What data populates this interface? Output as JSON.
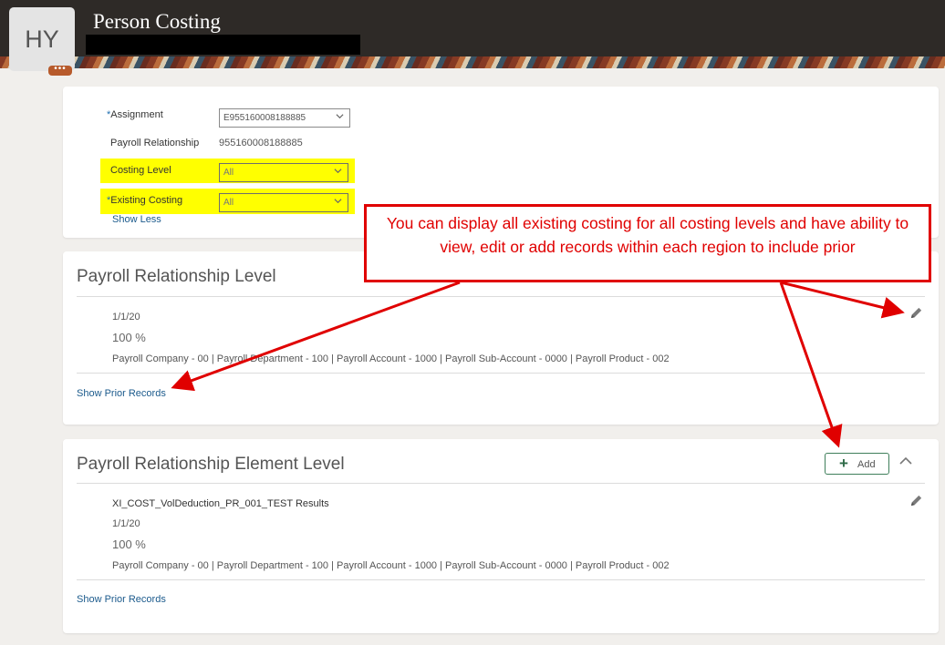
{
  "header": {
    "title": "Person Costing",
    "avatar_initials": "HY",
    "avatar_more": "•••"
  },
  "assignment_form": {
    "assignment_label": "Assignment",
    "assignment_value": "E955160008188885",
    "payroll_relationship_label": "Payroll Relationship",
    "payroll_relationship_value": "955160008188885",
    "costing_level_label": "Costing Level",
    "costing_level_value": "All",
    "existing_costing_label": "Existing Costing",
    "existing_costing_value": "All",
    "show_less": "Show Less",
    "required_marker": "*",
    "highlight_color": "#ffff00"
  },
  "sections": [
    {
      "title": "Payroll Relationship Level",
      "record": {
        "date": "1/1/20",
        "percent": "100 %",
        "account": "Payroll Company - 00 | Payroll Department - 100 | Payroll Account - 1000 | Payroll Sub-Account - 0000 | Payroll Product - 002"
      },
      "show_prior": "Show Prior Records"
    },
    {
      "title": "Payroll Relationship Element Level",
      "add_label": "Add",
      "record": {
        "element": "XI_COST_VolDeduction_PR_001_TEST Results",
        "date": "1/1/20",
        "percent": "100 %",
        "account": "Payroll Company - 00 | Payroll Department - 100 | Payroll Account - 1000 | Payroll Sub-Account - 0000 | Payroll Product - 002"
      },
      "show_prior": "Show Prior Records"
    }
  ],
  "annotation": {
    "text": "You can display all existing costing for all costing levels and have ability to view, edit or add records within each region to include prior",
    "color": "#e00000"
  },
  "icons": [
    "chevron-down-icon",
    "edit-pencil-icon",
    "plus-icon",
    "chevron-up-icon",
    "ellipsis-icon"
  ]
}
